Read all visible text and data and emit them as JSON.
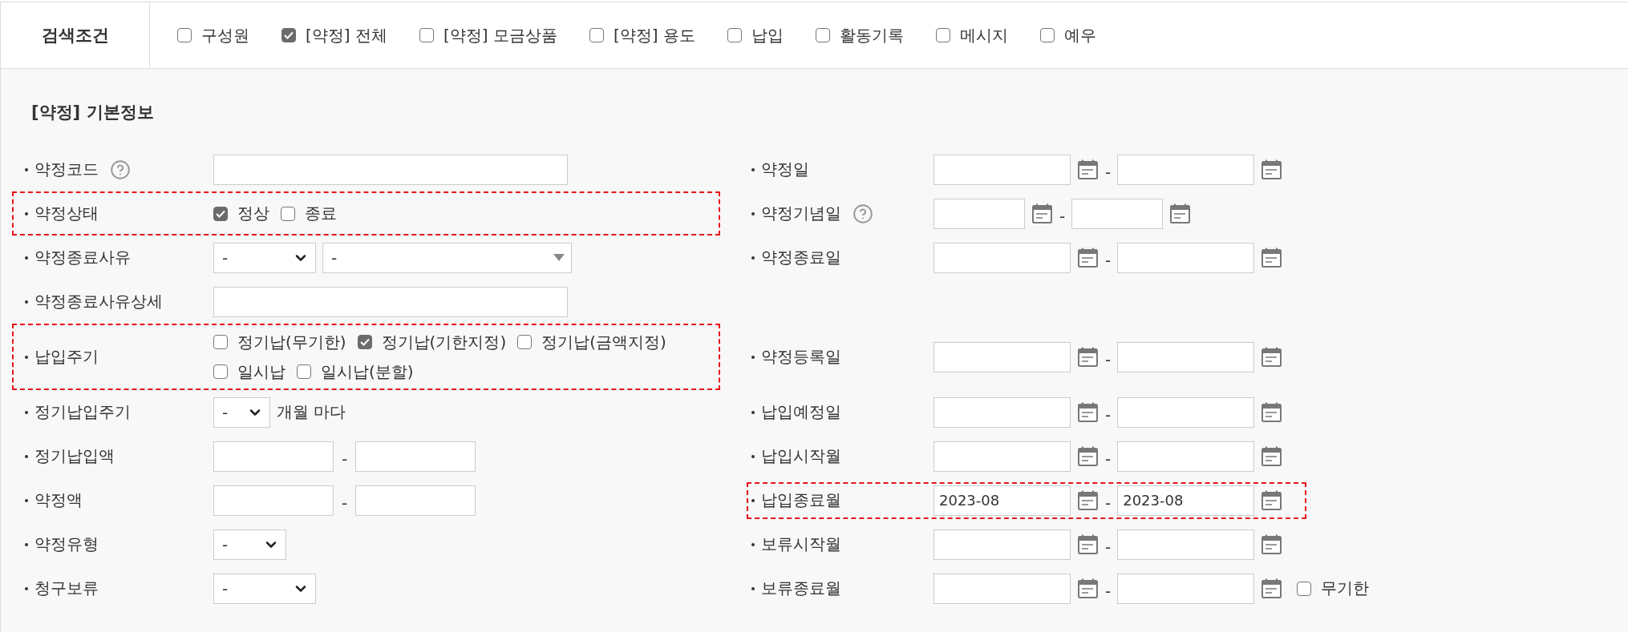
{
  "search_conditions": {
    "title": "검색조건",
    "options": [
      {
        "label": "구성원",
        "checked": false
      },
      {
        "label": "[약정] 전체",
        "checked": true
      },
      {
        "label": "[약정] 모금상품",
        "checked": false
      },
      {
        "label": "[약정] 용도",
        "checked": false
      },
      {
        "label": "납입",
        "checked": false
      },
      {
        "label": "활동기록",
        "checked": false
      },
      {
        "label": "메시지",
        "checked": false
      },
      {
        "label": "예우",
        "checked": false
      }
    ]
  },
  "section": {
    "title": "[약정] 기본정보"
  },
  "rows": [
    {
      "left": {
        "label": "약정코드",
        "help": true,
        "highlighted": false,
        "kind": "text"
      },
      "right": {
        "label": "약정일",
        "highlighted": false,
        "kind": "dates",
        "separator": "-"
      }
    },
    {
      "left": {
        "label": "약정상태",
        "highlighted": true,
        "kind": "checks",
        "options": [
          {
            "label": "정상",
            "checked": true
          },
          {
            "label": "종료",
            "checked": false
          }
        ]
      },
      "right": {
        "label": "약정기념일",
        "help": true,
        "highlighted": false,
        "kind": "shortdates",
        "separator": "-"
      }
    },
    {
      "left": {
        "label": "약정종료사유",
        "highlighted": false,
        "kind": "selects",
        "selects": [
          {
            "value": "-",
            "kind": "medium"
          },
          {
            "value": "-",
            "kind": "combo"
          }
        ]
      },
      "right": {
        "label": "약정종료일",
        "highlighted": false,
        "kind": "dates",
        "separator": "-"
      }
    },
    {
      "left": {
        "label": "약정종료사유상세",
        "highlighted": false,
        "kind": "text"
      }
    },
    {
      "left": {
        "label": "납입주기",
        "highlighted": true,
        "kind": "checks",
        "options": [
          {
            "label": "정기납(무기한)",
            "checked": false
          },
          {
            "label": "정기납(기한지정)",
            "checked": true
          },
          {
            "label": "정기납(금액지정)",
            "checked": false
          },
          {
            "label": "일시납",
            "checked": false
          },
          {
            "label": "일시납(분할)",
            "checked": false
          }
        ]
      },
      "right": {
        "label": "약정등록일",
        "highlighted": false,
        "kind": "dates",
        "separator": "-"
      }
    },
    {
      "left": {
        "label": "정기납입주기",
        "highlighted": false,
        "kind": "selects",
        "selects": [
          {
            "value": "-",
            "kind": "tiny"
          }
        ],
        "suffix": "개월 마다"
      },
      "right": {
        "label": "납입예정일",
        "highlighted": false,
        "kind": "dates",
        "separator": "-"
      }
    },
    {
      "left": {
        "label": "정기납입액",
        "highlighted": false,
        "kind": "range",
        "separator": "-"
      },
      "right": {
        "label": "납입시작월",
        "highlighted": false,
        "kind": "dates",
        "separator": "-"
      }
    },
    {
      "left": {
        "label": "약정액",
        "highlighted": false,
        "kind": "range",
        "separator": "-"
      },
      "right": {
        "label": "납입종료월",
        "highlighted": true,
        "kind": "dates",
        "separator": "-",
        "from": "2023-08",
        "to": "2023-08"
      }
    },
    {
      "left": {
        "label": "약정유형",
        "highlighted": false,
        "kind": "selects",
        "selects": [
          {
            "value": "-",
            "kind": "small"
          }
        ]
      },
      "right": {
        "label": "보류시작월",
        "highlighted": false,
        "kind": "dates",
        "separator": "-"
      }
    },
    {
      "left": {
        "label": "청구보류",
        "highlighted": false,
        "kind": "selects",
        "selects": [
          {
            "value": "-",
            "kind": "medium"
          }
        ]
      },
      "right": {
        "label": "보류종료월",
        "highlighted": false,
        "kind": "dates",
        "separator": "-",
        "extra": {
          "label": "무기한",
          "checked": false
        }
      }
    }
  ]
}
